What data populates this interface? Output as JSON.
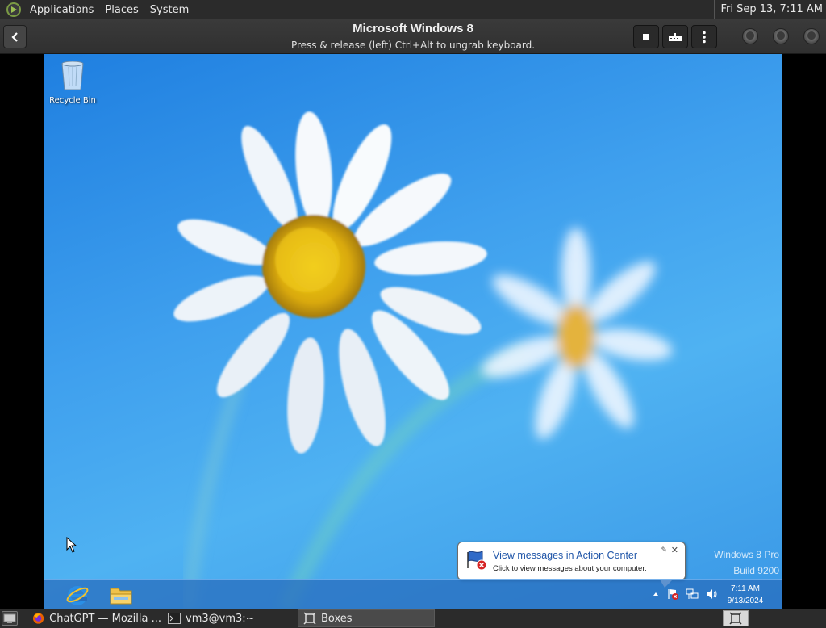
{
  "top_panel": {
    "menus": [
      "Applications",
      "Places",
      "System"
    ],
    "clock": "Fri Sep 13,  7:11 AM"
  },
  "boxes": {
    "title": "Microsoft Windows 8",
    "subtitle": "Press & release (left) Ctrl+Alt to ungrab keyboard.",
    "icons": {
      "back": "chevron-left-icon",
      "stop": "square-icon",
      "keyboard": "keyboard-icon",
      "menu": "vertical-dots-icon"
    }
  },
  "guest": {
    "desktop_icons": [
      {
        "label": "Recycle Bin",
        "icon": "recycle-bin-icon"
      }
    ],
    "notification": {
      "title": "View messages in Action Center",
      "text": "Click to view messages about your computer."
    },
    "watermark": {
      "line1": "Windows 8 Pro",
      "line2": "Build 9200"
    },
    "clock": {
      "time": "7:11 AM",
      "date": "9/13/2024"
    },
    "tray_icons": [
      "show-hidden-icons",
      "action-center-flag-icon",
      "network-icon",
      "volume-icon"
    ],
    "taskbar_pins": [
      "internet-explorer-icon",
      "file-explorer-icon"
    ],
    "colors": {
      "sky": "#3aa0ee",
      "taskbar": "#2e6eb8",
      "notification_title": "#1f55a8"
    }
  },
  "bottom_panel": {
    "tasks": [
      {
        "label": "ChatGPT — Mozilla ...",
        "icon": "firefox-icon",
        "active": false
      },
      {
        "label": "vm3@vm3:~",
        "icon": "terminal-icon",
        "active": false
      },
      {
        "label": "Boxes",
        "icon": "boxes-icon",
        "active": true
      }
    ]
  }
}
